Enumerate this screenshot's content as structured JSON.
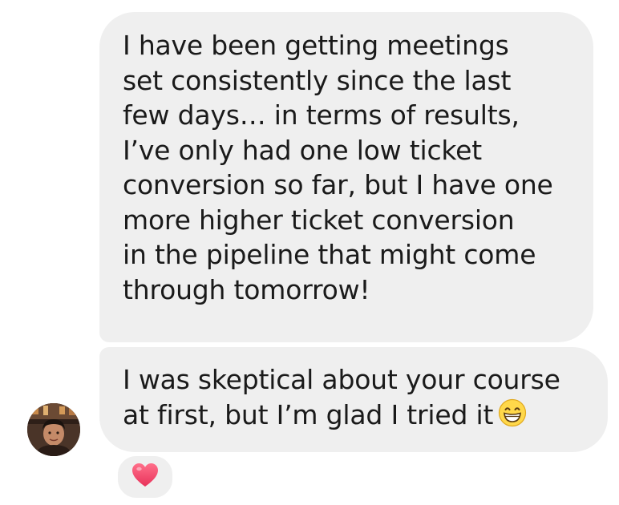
{
  "messages": [
    {
      "text": "I have been getting meetings\nset consistently since the last\nfew days… in terms of results,\nI’ve only had one low ticket\nconversion so far, but I have one\nmore higher ticket conversion\nin the pipeline that might come\nthrough tomorrow!"
    },
    {
      "text": "I was skeptical about your course\nat first, but I’m glad I tried it",
      "emoji_icon": "grinning-face-icon"
    }
  ],
  "reaction": {
    "icon": "heart-icon",
    "color": "#f0506e"
  },
  "colors": {
    "bubble_bg": "#efefef",
    "text": "#1a1a1a"
  }
}
